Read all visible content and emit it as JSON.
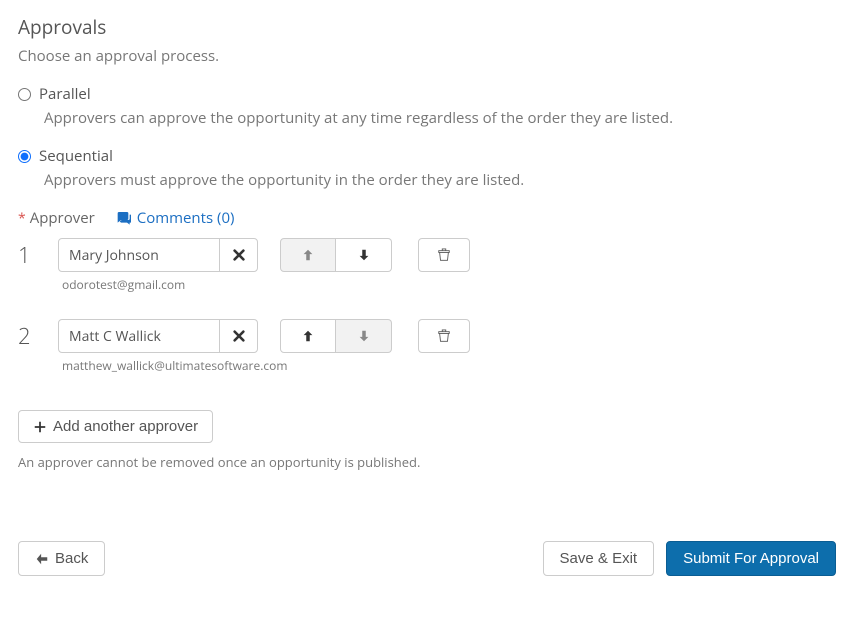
{
  "title": "Approvals",
  "subtitle": "Choose an approval process.",
  "options": {
    "parallel": {
      "label": "Parallel",
      "desc": "Approvers can approve the opportunity at any time regardless of the order they are listed."
    },
    "sequential": {
      "label": "Sequential",
      "desc": "Approvers must approve the opportunity in the order they are listed."
    },
    "selected": "sequential"
  },
  "fieldLabel": "Approver",
  "commentsLabel": "Comments (0)",
  "approvers": [
    {
      "order": "1",
      "name": "Mary Johnson",
      "email": "odorotest@gmail.com"
    },
    {
      "order": "2",
      "name": "Matt C Wallick",
      "email": "matthew_wallick@ultimatesoftware.com"
    }
  ],
  "addLabel": "Add another approver",
  "note": "An approver cannot be removed once an opportunity is published.",
  "footer": {
    "back": "Back",
    "save": "Save & Exit",
    "submit": "Submit For Approval"
  }
}
